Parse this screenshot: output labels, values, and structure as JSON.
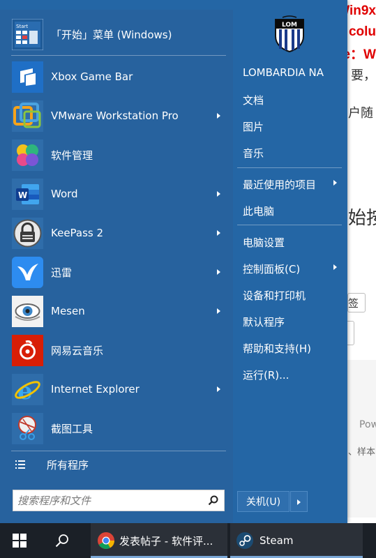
{
  "background": {
    "red_lines": [
      "Win9x",
      "colu",
      "e：W"
    ],
    "text_fragments": [
      "要，",
      "户随",
      "始按",
      "签",
      "Pow",
      "、样本"
    ]
  },
  "start_menu": {
    "header": {
      "label": "「开始」菜单 (Windows)"
    },
    "programs": [
      {
        "label": "Xbox Game Bar",
        "icon": "xbox-game-bar-icon",
        "has_submenu": false
      },
      {
        "label": "VMware Workstation Pro",
        "icon": "vmware-icon",
        "has_submenu": true
      },
      {
        "label": "软件管理",
        "icon": "software-manager-icon",
        "has_submenu": false
      },
      {
        "label": "Word",
        "icon": "word-icon",
        "has_submenu": true
      },
      {
        "label": "KeePass 2",
        "icon": "keepass-icon",
        "has_submenu": true
      },
      {
        "label": "迅雷",
        "icon": "xunlei-icon",
        "has_submenu": true
      },
      {
        "label": "Mesen",
        "icon": "mesen-icon",
        "has_submenu": true
      },
      {
        "label": "网易云音乐",
        "icon": "netease-music-icon",
        "has_submenu": false
      },
      {
        "label": "Internet Explorer",
        "icon": "internet-explorer-icon",
        "has_submenu": true
      },
      {
        "label": "截图工具",
        "icon": "snipping-tool-icon",
        "has_submenu": false
      }
    ],
    "all_programs": "所有程序",
    "search": {
      "placeholder": "搜索程序和文件"
    },
    "user_name": "LOMBARDIA NA",
    "avatar_text": "LOM",
    "right_items": {
      "documents": "文档",
      "pictures": "图片",
      "music": "音乐",
      "recent": "最近使用的项目",
      "computer": "此电脑",
      "pc_settings": "电脑设置",
      "control_panel": "控制面板(C)",
      "devices": "设备和打印机",
      "default_programs": "默认程序",
      "help": "帮助和支持(H)",
      "run": "运行(R)..."
    },
    "shutdown": "关机(U)"
  },
  "taskbar": {
    "chrome_label": "发表帖子 - 软件评...",
    "steam_label": "Steam"
  },
  "colors": {
    "menu_left": "#27629e",
    "menu_right": "#2466a5",
    "taskbar": "#1b2027"
  }
}
